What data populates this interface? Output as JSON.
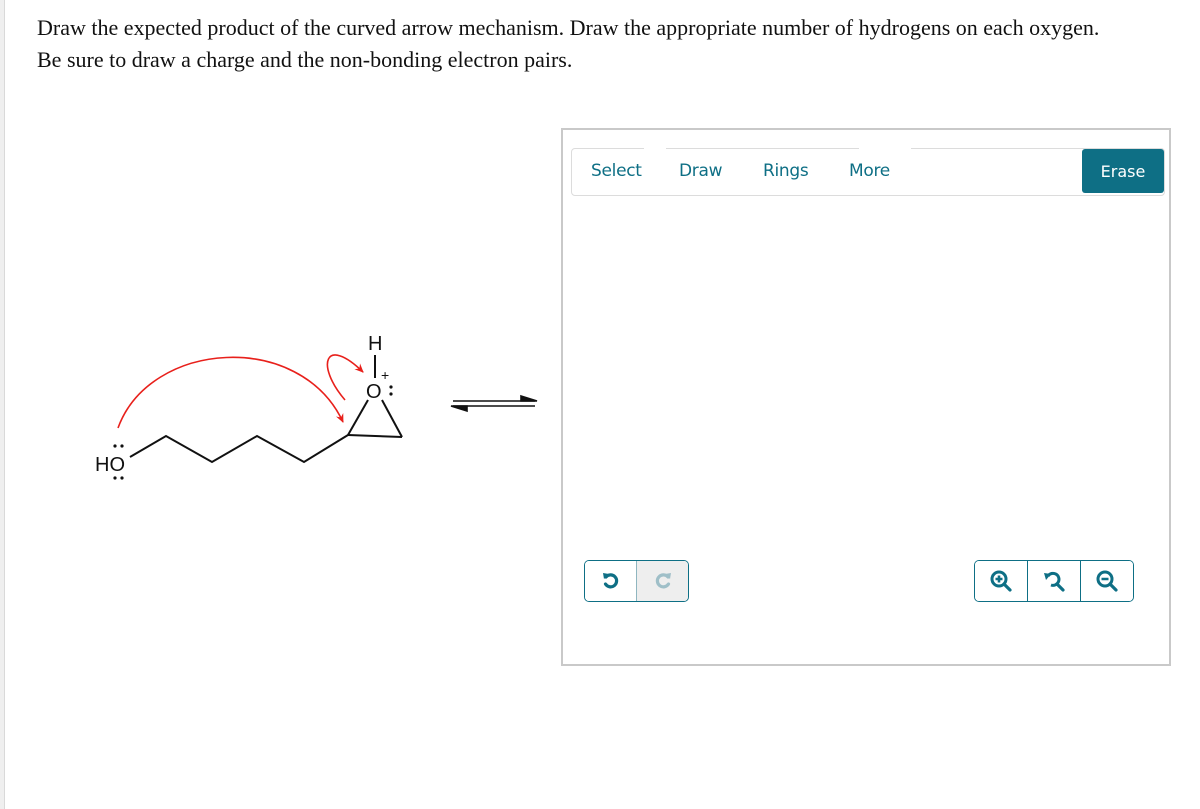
{
  "question": {
    "line1": "Draw the expected product of the curved arrow mechanism. Draw the appropriate number of hydrogens on each oxygen.",
    "line2": "Be sure to draw a charge and the non-bonding electron pairs."
  },
  "mechanism": {
    "hydroxyl_label": "HO",
    "epoxide_oxygen_label": "O",
    "epoxide_hydrogen_label": "H",
    "charge_label": "+",
    "arrow_color": "#e8201b",
    "equilibrium_arrow": "reversible"
  },
  "editor": {
    "toolbar": {
      "tabs": [
        {
          "label": "Select"
        },
        {
          "label": "Draw"
        },
        {
          "label": "Rings"
        },
        {
          "label": "More"
        }
      ],
      "erase_label": "Erase"
    },
    "history": {
      "undo_icon": "undo-icon",
      "redo_icon": "redo-icon",
      "redo_enabled": false
    },
    "zoom_controls": {
      "zoom_in_icon": "zoom-in-icon",
      "reset_icon": "zoom-reset-icon",
      "zoom_out_icon": "zoom-out-icon"
    },
    "accent_color": "#0e6f85"
  }
}
